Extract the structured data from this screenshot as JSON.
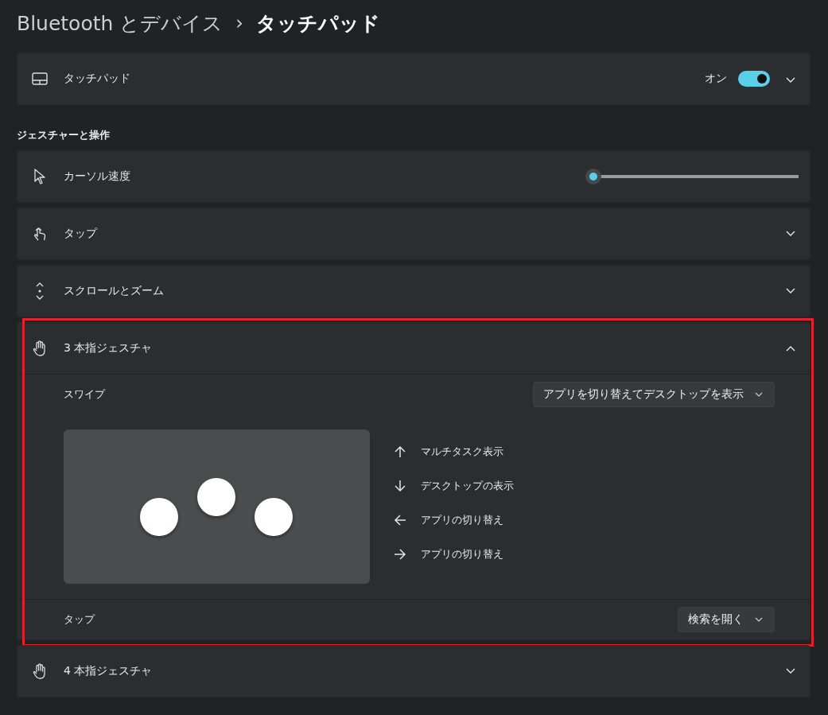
{
  "breadcrumb": {
    "parent": "Bluetooth とデバイス",
    "separator": "›",
    "current": "タッチパッド"
  },
  "touchpad": {
    "label": "タッチパッド",
    "state_label": "オン",
    "on": true,
    "expanded": false
  },
  "section_title": "ジェスチャーと操作",
  "items": [
    {
      "kind": "slider",
      "label": "カーソル速度",
      "level": 0
    },
    {
      "kind": "expander",
      "label": "タップ",
      "expanded": false
    },
    {
      "kind": "expander",
      "label": "スクロールとズーム",
      "expanded": false
    },
    {
      "kind": "expander",
      "label": "3 本指ジェスチャ",
      "expanded": true,
      "highlighted": true,
      "swipe": {
        "label": "スワイプ",
        "value": "アプリを切り替えてデスクトップを表示"
      },
      "gestures": [
        {
          "label": "マルチタスク表示"
        },
        {
          "label": "デスクトップの表示"
        },
        {
          "label": "アプリの切り替え"
        },
        {
          "label": "アプリの切り替え"
        }
      ],
      "tap": {
        "label": "タップ",
        "value": "検索を開く"
      }
    },
    {
      "kind": "expander",
      "label": "4 本指ジェスチャ",
      "expanded": false
    }
  ]
}
